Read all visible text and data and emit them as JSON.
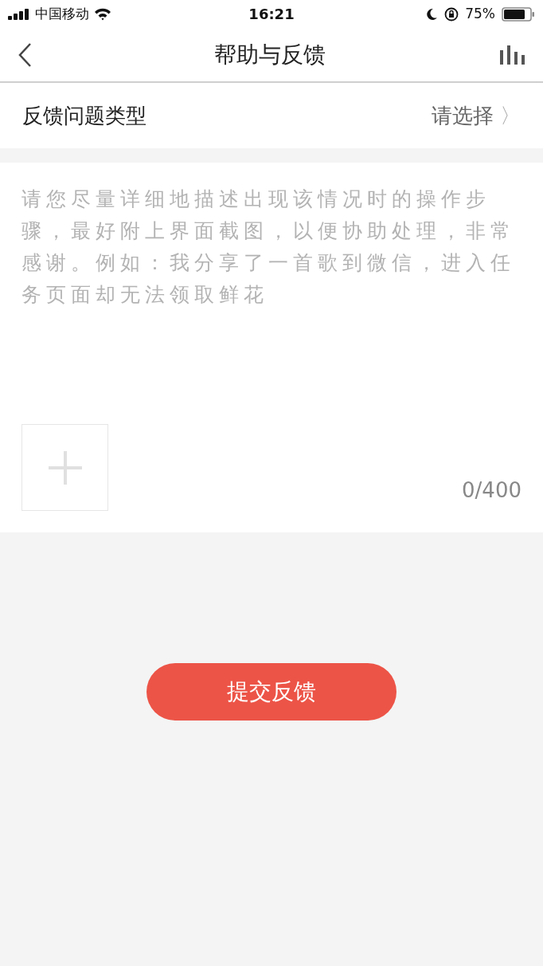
{
  "status_bar": {
    "carrier": "中国移动",
    "time": "16:21",
    "battery": "75%"
  },
  "nav": {
    "title": "帮助与反馈"
  },
  "type_row": {
    "label": "反馈问题类型",
    "value": "请选择",
    "chevron": "〉"
  },
  "feedback": {
    "placeholder": "请您尽量详细地描述出现该情况时的操作步骤，最好附上界面截图，以便协助处理，非常感谢。例如：我分享了一首歌到微信，进入任务页面却无法领取鲜花",
    "counter": "0/400"
  },
  "submit": {
    "label": "提交反馈"
  }
}
